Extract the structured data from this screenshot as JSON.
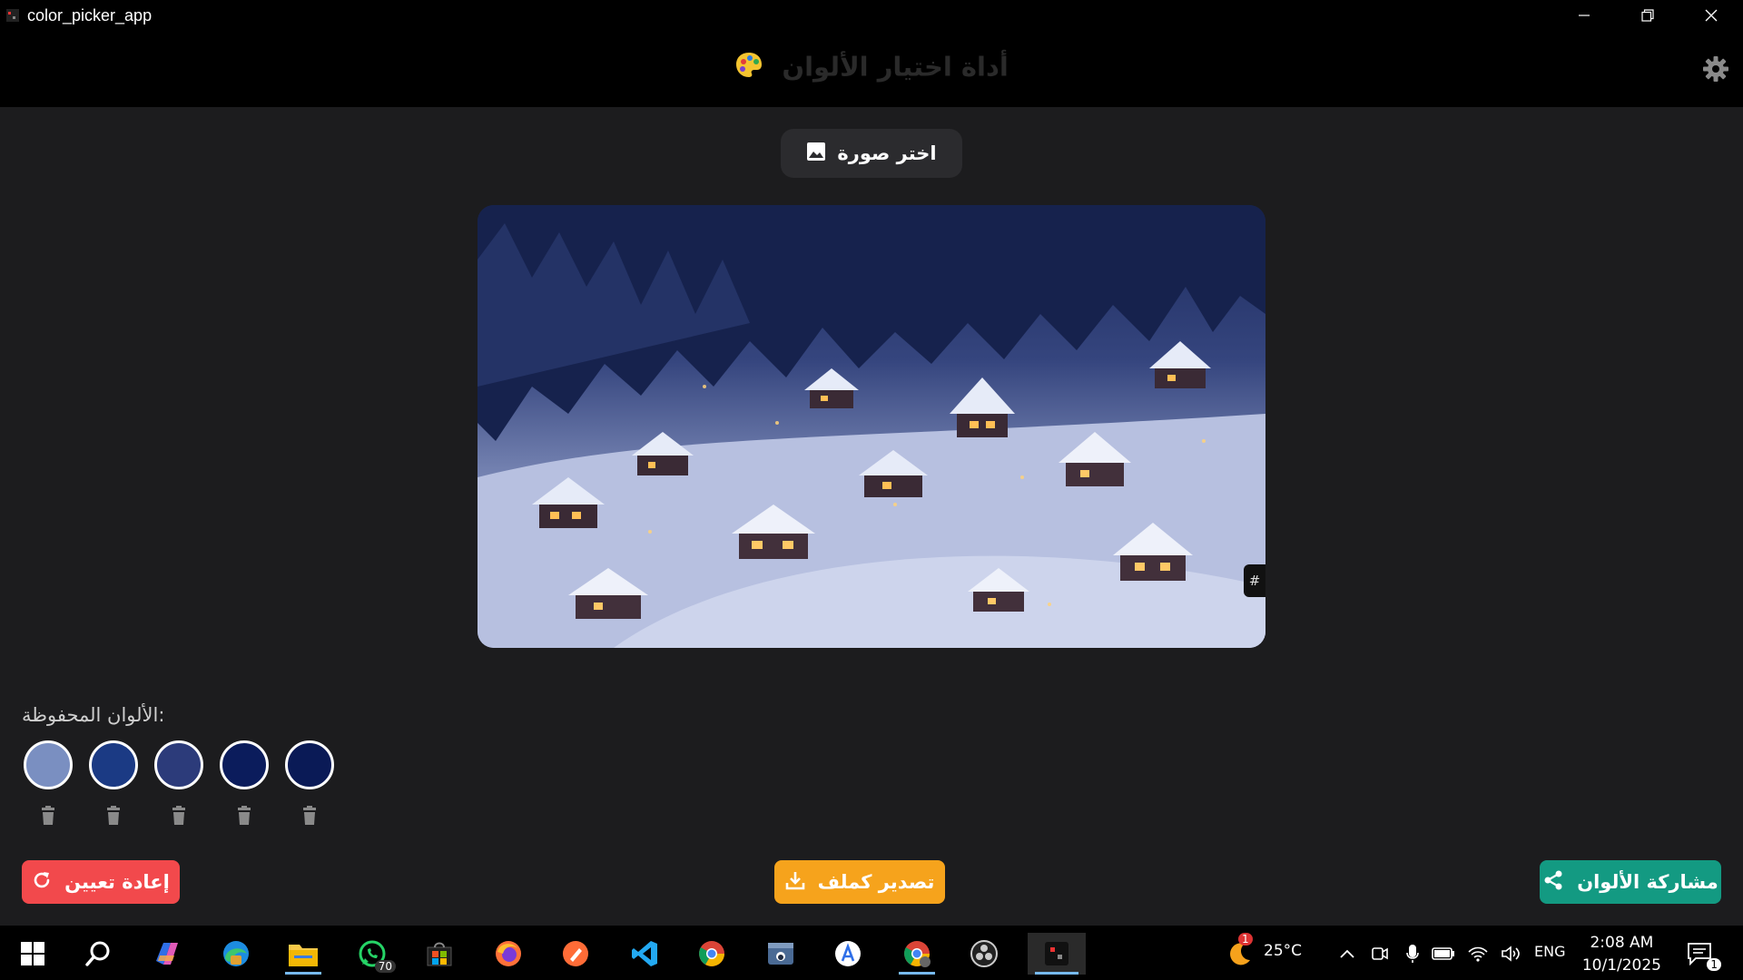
{
  "window": {
    "title": "color_picker_app"
  },
  "appbar": {
    "heading": "أداة اختيار الألوان"
  },
  "picker": {
    "pick_label": "اختر صورة",
    "hex_marker": "#"
  },
  "saved": {
    "label": "الألوان المحفوظة:",
    "colors": [
      "#7a8fc1",
      "#1b3a84",
      "#2c3b7a",
      "#0b1c5c",
      "#0a1a56"
    ]
  },
  "actions": {
    "reset_label": "إعادة تعيين",
    "export_label": "تصدير كملف",
    "share_label": "مشاركة الألوان"
  },
  "colors": {
    "reset": "#f2494c",
    "export": "#f6a31c",
    "share": "#139a82"
  },
  "taskbar": {
    "whatsapp_badge": "70",
    "weather_badge": "1",
    "temperature": "25°C",
    "language": "ENG",
    "time": "2:08 AM",
    "date": "10/1/2025",
    "notification_count": "1"
  }
}
